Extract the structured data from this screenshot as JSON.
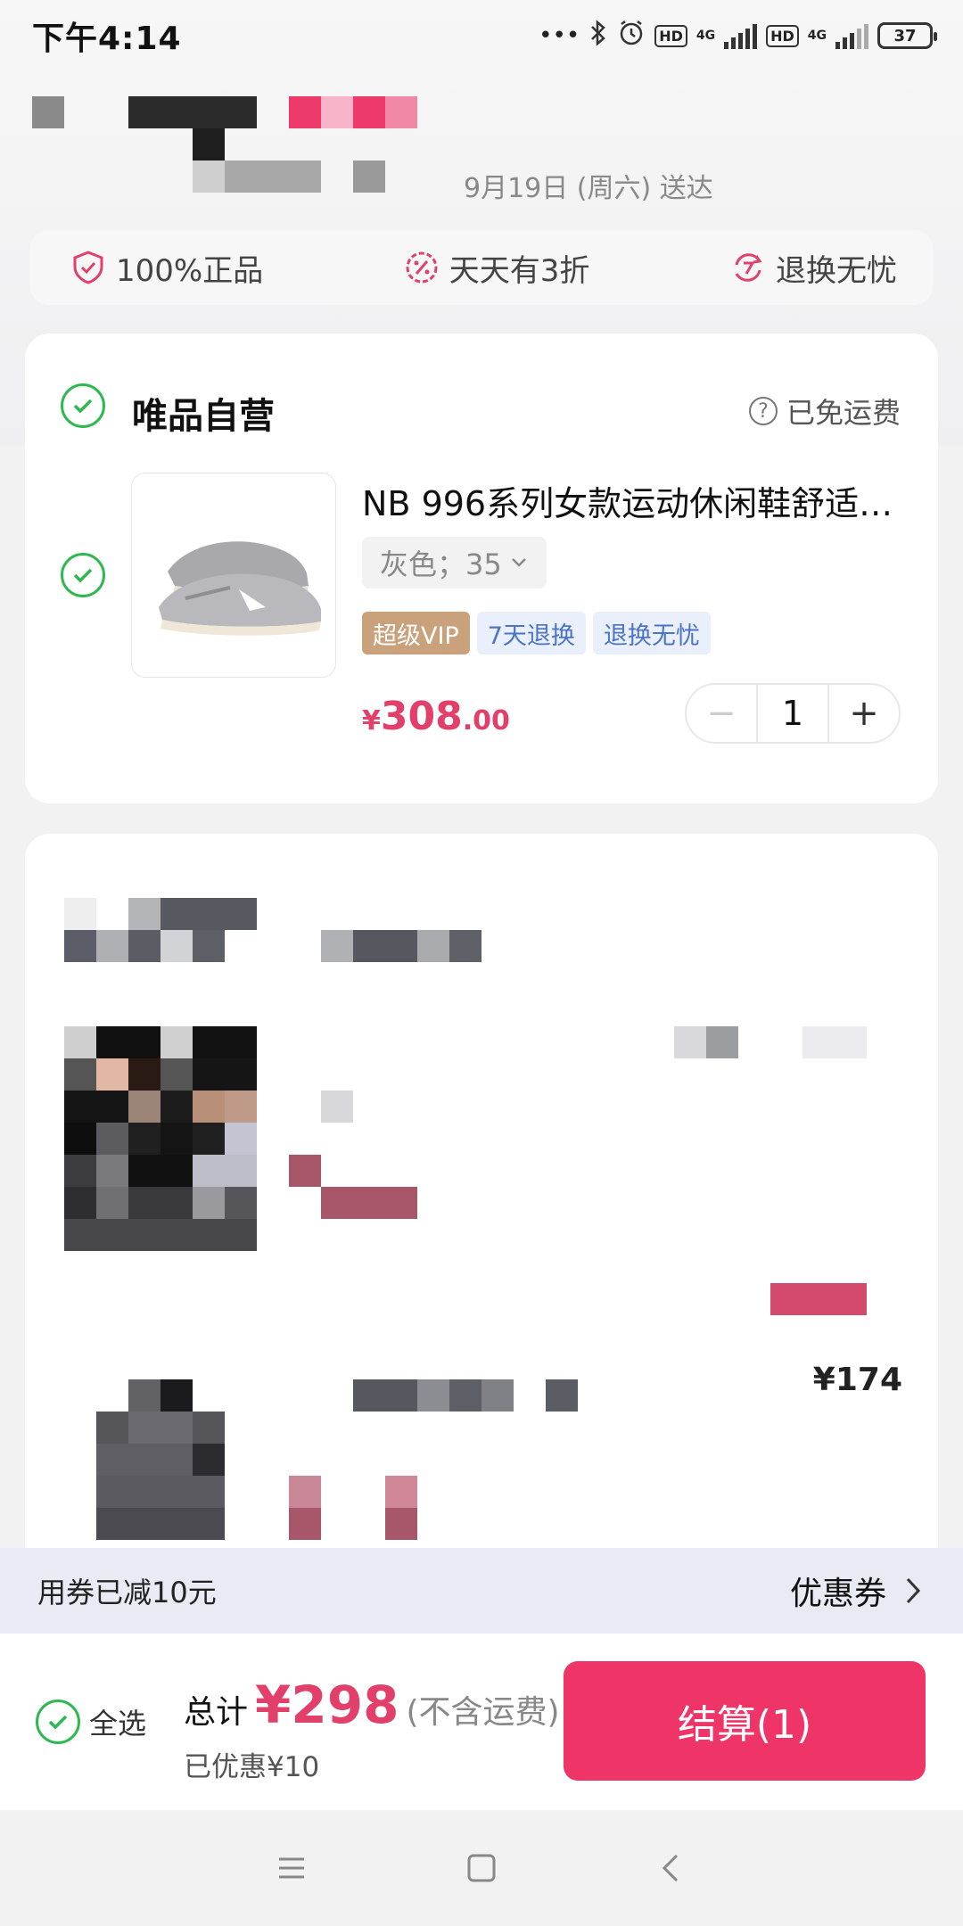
{
  "status_bar": {
    "time": "下午4:14",
    "battery": "37",
    "network_1": "4G",
    "network_2": "4G",
    "hd": "HD"
  },
  "delivery": {
    "text": "9月19日 (周六) 送达"
  },
  "guarantees": [
    {
      "label": "100%正品",
      "icon": "shield-icon"
    },
    {
      "label": "天天有3折",
      "icon": "discount-icon"
    },
    {
      "label": "退换无忧",
      "icon": "return-icon"
    }
  ],
  "shop": {
    "name": "唯品自营",
    "shipping": "已免运费",
    "product": {
      "title": "NB 996系列女款运动休闲鞋舒适…",
      "sku": "灰色；35",
      "tags": [
        "超级VIP",
        "7天退换",
        "退换无忧"
      ],
      "price_symbol": "¥",
      "price_int": "308",
      "price_dec": ".00",
      "quantity": "1"
    }
  },
  "second_card": {
    "price_fragment": "¥174"
  },
  "coupon_bar": {
    "left": "用券已减10元",
    "right": "优惠券"
  },
  "checkout": {
    "select_all": "全选",
    "total_label": "总计",
    "total_value": "¥298",
    "total_note": "(不含运费)",
    "saved": "已优惠¥10",
    "button": "结算(1)"
  },
  "colors": {
    "accent": "#ef3467",
    "price": "#e23f6a",
    "check_green": "#2fb84f",
    "vip_tag": "#c9a27b"
  }
}
